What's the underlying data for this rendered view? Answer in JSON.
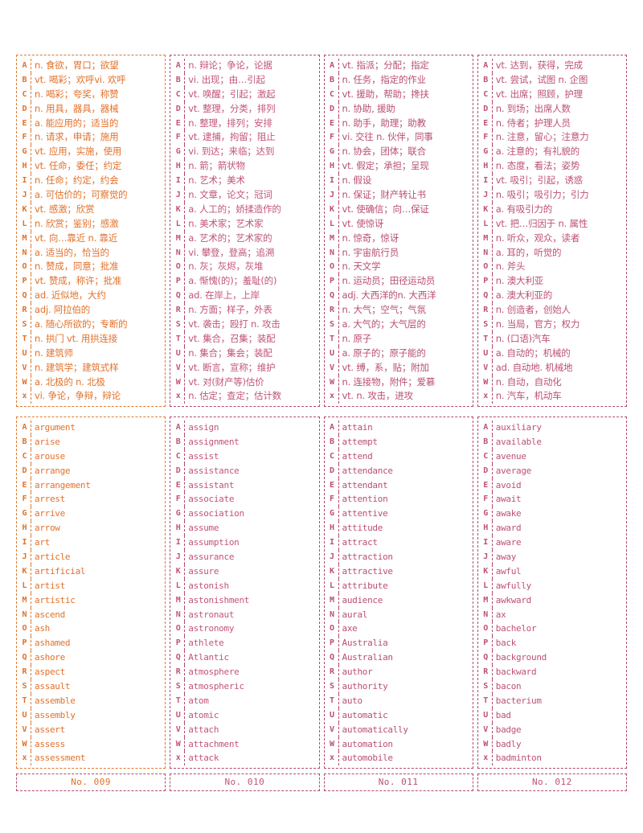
{
  "sheet": {
    "columns": 4,
    "rows": 2,
    "letters": [
      "A",
      "B",
      "C",
      "D",
      "E",
      "F",
      "G",
      "H",
      "I",
      "J",
      "K",
      "L",
      "M",
      "N",
      "O",
      "P",
      "Q",
      "R",
      "S",
      "T",
      "U",
      "V",
      "W",
      "x"
    ],
    "colors": {
      "card_009": "#e2712a",
      "card_010": "#c2547c",
      "card_011": "#b94f72",
      "card_012": "#bd5175",
      "border_pink": "#b34a6e",
      "border_orange": "#e07a2f",
      "background": "#ffffff"
    }
  },
  "cards": [
    {
      "number": "No. 009",
      "color_class": "c-orange",
      "border_class": "orange",
      "definitions": [
        "n. 食欲，胃口；欲望",
        "vt. 喝彩；欢呼vi. 欢呼",
        "n. 喝彩；夸奖，称赞",
        "n. 用具，器具，器械",
        "a. 能应用的；适当的",
        "n. 请求，申请；施用",
        "vt. 应用，实施，使用",
        "vt. 任命，委任；约定",
        "n. 任命；约定，约会",
        "a. 可估价的；可察觉的",
        "vt. 感激；欣赏",
        "n. 欣赏；鉴别；感激",
        "vt. 向…靠近 n. 靠近",
        "a. 适当的，恰当的",
        "n. 赞成，同意；批准",
        "vt. 赞成，称许；批准",
        "ad. 近似地，大约",
        "adj. 阿拉伯的",
        "a. 随心所欲的；专断的",
        "n. 拱门 vt. 用拱连接",
        "n. 建筑师",
        "n. 建筑学；建筑式样",
        "a. 北极的 n. 北极",
        "vi. 争论，争辩，辩论"
      ],
      "words": [
        "argument",
        "arise",
        "arouse",
        "arrange",
        "arrangement",
        "arrest",
        "arrive",
        "arrow",
        "art",
        "article",
        "artificial",
        "artist",
        "artistic",
        "ascend",
        "ash",
        "ashamed",
        "ashore",
        "aspect",
        "assault",
        "assemble",
        "assembly",
        "assert",
        "assess",
        "assessment"
      ]
    },
    {
      "number": "No. 010",
      "color_class": "c-pink",
      "border_class": "pink",
      "definitions": [
        "n. 辩论；争论，论据",
        "vi. 出现；由…引起",
        "vt. 唤醒；引起；激起",
        "vt. 整理，分类，排列",
        "n. 整理，排列；安排",
        "vt. 逮捕，拘留；阻止",
        "vi. 到达；来临；达到",
        "n. 箭；箭状物",
        "n. 艺术；美术",
        "n. 文章，论文；冠词",
        "a. 人工的；娇揉造作的",
        "n. 美术家；艺术家",
        "a. 艺术的；艺术家的",
        "vi. 攀登，登高；追溯",
        "n. 灰；灰烬，灰堆",
        "a. 惭愧(的)；羞耻(的)",
        "ad. 在岸上，上岸",
        "n. 方面；样子，外表",
        "vt. 袭击；殴打 n. 攻击",
        "vt. 集合，召集；装配",
        "n. 集合；集会；装配",
        "vt. 断言，宣称；维护",
        "vt. 对(财产等)估价",
        "n. 估定；查定；估计数"
      ],
      "words": [
        "assign",
        "assignment",
        "assist",
        "assistance",
        "assistant",
        "associate",
        "association",
        "assume",
        "assumption",
        "assurance",
        "assure",
        "astonish",
        "astonishment",
        "astronaut",
        "astronomy",
        "athlete",
        "Atlantic",
        "atmosphere",
        "atmospheric",
        "atom",
        "atomic",
        "attach",
        "attachment",
        "attack"
      ]
    },
    {
      "number": "No. 011",
      "color_class": "c-mauve",
      "border_class": "pink",
      "definitions": [
        "vt. 指派；分配；指定",
        "n. 任务，指定的作业",
        "vt. 援助，帮助；搀扶",
        "n. 协助, 援助",
        "n. 助手，助理；助教",
        "vi. 交往 n. 伙伴，同事",
        "n. 协会，团体；联合",
        "vt. 假定；承担；呈现",
        "n. 假设",
        "n. 保证；财产转让书",
        "vt. 使确信；向…保证",
        "vt. 使惊讶",
        "n. 惊奇，惊讶",
        "n. 宇宙航行员",
        "n. 天文学",
        "n. 运动员；田径运动员",
        "adj. 大西洋的n. 大西洋",
        "n. 大气；空气；气氛",
        "a. 大气的；大气层的",
        "n. 原子",
        "a. 原子的；原子能的",
        "vt. 缚，系，贴；附加",
        "n. 连接物，附件；爱慕",
        "vt. n. 攻击，进攻"
      ],
      "words": [
        "attain",
        "attempt",
        "attend",
        "attendance",
        "attendant",
        "attention",
        "attentive",
        "attitude",
        "attract",
        "attraction",
        "attractive",
        "attribute",
        "audience",
        "aural",
        "axe",
        "Australia",
        "Australian",
        "author",
        "authority",
        "auto",
        "automatic",
        "automatically",
        "automation",
        "automobile"
      ]
    },
    {
      "number": "No. 012",
      "color_class": "c-rose",
      "border_class": "pink",
      "definitions": [
        "vt. 达到，获得，完成",
        "vt. 尝试，试图 n. 企图",
        "vt. 出席；照顾，护理",
        "n. 到场；出席人数",
        "n. 侍者；护理人员",
        "n. 注意，留心；注意力",
        "a. 注意的；有礼貌的",
        "n. 态度，看法；姿势",
        "vt. 吸引；引起，诱惑",
        "n. 吸引；吸引力；引力",
        "a. 有吸引力的",
        "vt. 把…归因于 n. 属性",
        "n. 听众，观众，读者",
        "a. 耳的，听觉的",
        "n. 斧头",
        "n. 澳大利亚",
        "a. 澳大利亚的",
        "n. 创造者，创始人",
        "n. 当局，官方；权力",
        "n. (口语)汽车",
        "a. 自动的；机械的",
        "ad. 自动地. 机械地",
        "n. 自动，自动化",
        "n. 汽车，机动车"
      ],
      "words": [
        "auxiliary",
        "available",
        "avenue",
        "average",
        "avoid",
        "await",
        "awake",
        "award",
        "aware",
        "away",
        "awful",
        "awfully",
        "awkward",
        "ax",
        "bachelor",
        "back",
        "background",
        "backward",
        "bacon",
        "bacterium",
        "bad",
        "badge",
        "badly",
        "badminton"
      ]
    }
  ]
}
